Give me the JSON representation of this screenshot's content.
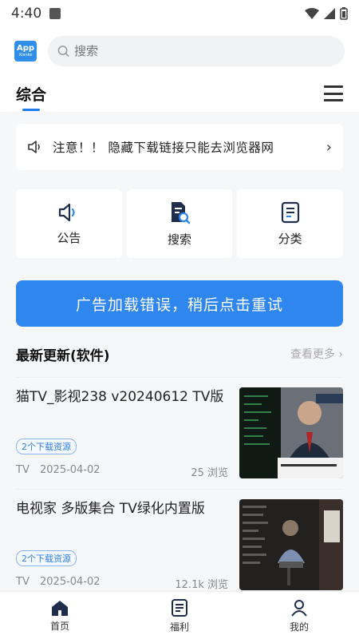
{
  "status_bar": {
    "time": "4:40"
  },
  "app": {
    "logo_text": "App",
    "logo_sub": "Xianke"
  },
  "search": {
    "placeholder": "搜索"
  },
  "tabs": [
    {
      "label": "综合"
    }
  ],
  "notice": {
    "text": "注意！！ 隐藏下载链接只能去浏览器网"
  },
  "quick_actions": [
    {
      "label": "公告",
      "icon": "speaker-icon"
    },
    {
      "label": "搜索",
      "icon": "doc-search-icon"
    },
    {
      "label": "分类",
      "icon": "list-icon"
    }
  ],
  "ad_banner": {
    "text": "广告加载错误，稍后点击重试"
  },
  "section": {
    "title": "最新更新(软件)",
    "see_more": "查看更多 ›"
  },
  "items": [
    {
      "title": "猫TV_影视238 v20240612 TV版",
      "badge": "2个下载资源",
      "category": "TV",
      "date": "2025-04-02",
      "views": "25 浏览"
    },
    {
      "title": "电视家  多版集合 TV绿化内置版",
      "badge": "2个下载资源",
      "category": "TV",
      "date": "2025-04-02",
      "views": "12.1k 浏览"
    }
  ],
  "bottom_nav": [
    {
      "label": "首页",
      "icon": "home-icon"
    },
    {
      "label": "福利",
      "icon": "doc-icon"
    },
    {
      "label": "我的",
      "icon": "user-icon"
    }
  ],
  "colors": {
    "accent": "#2f86ee",
    "badge_border": "#8db5f0"
  }
}
